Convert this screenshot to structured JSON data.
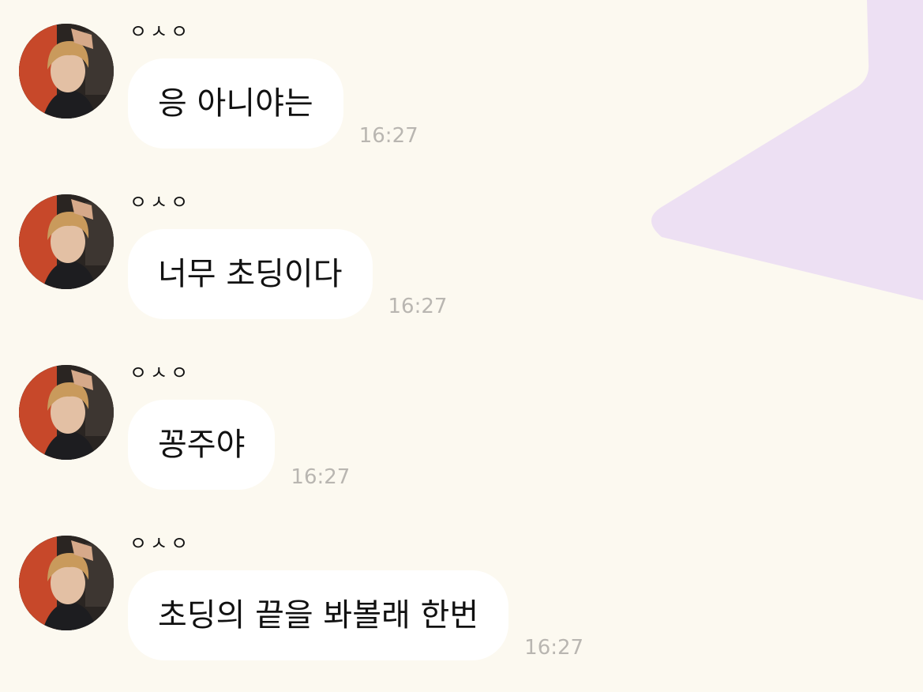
{
  "colors": {
    "background": "#fcf9f0",
    "bubble": "#ffffff",
    "text": "#111111",
    "timestamp": "#b9b6b1",
    "star": "#ede0f3"
  },
  "chat": {
    "messages": [
      {
        "sender": "ㅇㅅㅇ",
        "text": "응 아니야는",
        "time": "16:27",
        "avatar": "profile-photo"
      },
      {
        "sender": "ㅇㅅㅇ",
        "text": "너무 초딩이다",
        "time": "16:27",
        "avatar": "profile-photo"
      },
      {
        "sender": "ㅇㅅㅇ",
        "text": "꽁주야",
        "time": "16:27",
        "avatar": "profile-photo"
      },
      {
        "sender": "ㅇㅅㅇ",
        "text": "초딩의 끝을 봐볼래 한번",
        "time": "16:27",
        "avatar": "profile-photo"
      }
    ]
  }
}
